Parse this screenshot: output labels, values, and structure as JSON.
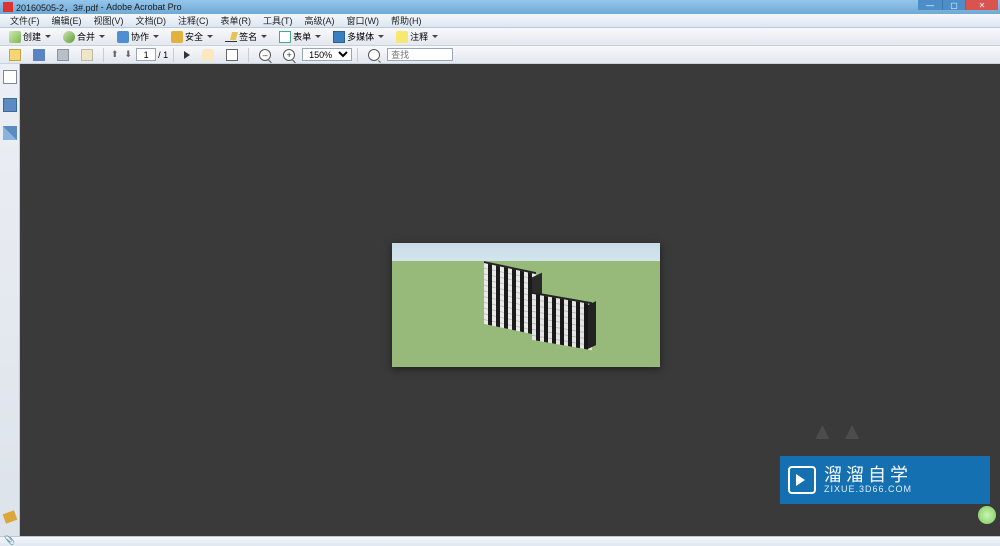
{
  "titlebar": {
    "document": "20160505-2，3#.pdf",
    "app": "Adobe Acrobat Pro"
  },
  "menu": {
    "file": "文件(F)",
    "edit": "编辑(E)",
    "view": "视图(V)",
    "document": "文档(D)",
    "comments": "注释(C)",
    "forms": "表单(R)",
    "tools": "工具(T)",
    "advanced": "高级(A)",
    "window": "窗口(W)",
    "help": "帮助(H)"
  },
  "toolbar1": {
    "create": "创建",
    "merge": "合并",
    "collab": "协作",
    "secure": "安全",
    "sign": "签名",
    "forms": "表单",
    "media": "多媒体",
    "comment": "注释"
  },
  "toolbar2": {
    "page_current": "1",
    "page_total": "/ 1",
    "zoom": "150%",
    "search_placeholder": "查找"
  },
  "watermark": {
    "line1": "溜溜自学",
    "line2": "ZIXUE.3D66.COM"
  },
  "ghost": "▲▲"
}
